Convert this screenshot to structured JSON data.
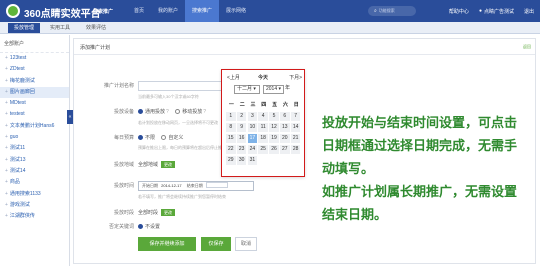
{
  "header": {
    "brand": "360点睛实效平台",
    "subbrand": "搜索推广",
    "nav": [
      "首页",
      "我的账户",
      "搜索推广",
      "展示网络"
    ],
    "active_nav": 2,
    "search_placeholder": "功能搜索",
    "right_links": [
      "帮助中心",
      "点睛广告测试",
      "退出"
    ]
  },
  "subnav": {
    "tabs": [
      "投放管理",
      "实用工具",
      "效果评估"
    ]
  },
  "sidebar": {
    "title": "全部账户",
    "items": [
      "123test",
      "ZDtest",
      "梅花鹿测试",
      "图片画廊回",
      "MDtest",
      "testest",
      "文本黄鹏计划Hans6",
      "guo",
      "测试11",
      "测试13",
      "测试14",
      "商品",
      "通用搜索1133",
      "游戏测试",
      "江湖群侠传"
    ],
    "selected": 3,
    "toggle": "«"
  },
  "main": {
    "title": "添加推广计划",
    "tag": "返回",
    "form": {
      "plan_name_label": "推广计划名称",
      "plan_name_hint": "当前最多可输入30个汉字或60字符",
      "device_label": "投放设备",
      "device_opt1": "通用投放",
      "device_opt2": "移动投放",
      "device_hint": "若计划投放在移动网页，一旦选择将不可更改",
      "budget_label": "每日预算",
      "budget_opt1": "不限",
      "budget_opt2": "自定义",
      "budget_hint": "预算在推出上限，每日的预算将在超出后停止推广",
      "region_label": "投放地域",
      "region_value": "全部地域",
      "date_label": "投放时间",
      "start_label": "开始日期",
      "start_value": "2014-12-17",
      "end_label": "结束日期",
      "date_hint": "若不填写，推广将会继续持续推广到您暂停时结束",
      "period_label": "投放时段",
      "period_value": "全部时段",
      "edit_label": "更改",
      "negative_label": "否定关键词",
      "negative_opt": "不设置",
      "save_new_label": "保存并继续添加",
      "save_label": "仅保存",
      "cancel_label": "取消"
    }
  },
  "datepicker": {
    "prev": "<上月",
    "today": "今天",
    "next": "下月>",
    "month": "十二月",
    "year": "2014",
    "weekdays": [
      "一",
      "二",
      "三",
      "四",
      "五",
      "六",
      "日"
    ],
    "days": [
      [
        "1",
        "2",
        "3",
        "4",
        "5",
        "6",
        "7"
      ],
      [
        "8",
        "9",
        "10",
        "11",
        "12",
        "13",
        "14"
      ],
      [
        "15",
        "16",
        "17",
        "18",
        "19",
        "20",
        "21"
      ],
      [
        "22",
        "23",
        "24",
        "25",
        "26",
        "27",
        "28"
      ],
      [
        "29",
        "30",
        "31"
      ]
    ],
    "today_day": "17"
  },
  "annotation": {
    "lines": [
      "投放开始与结束时间设置，可点击",
      "日期框通过选择日期完成，无需手",
      "动填写。",
      "如推广计划属长期推广，无需设置",
      "结束日期。"
    ],
    "color": "#2f8a2f"
  }
}
